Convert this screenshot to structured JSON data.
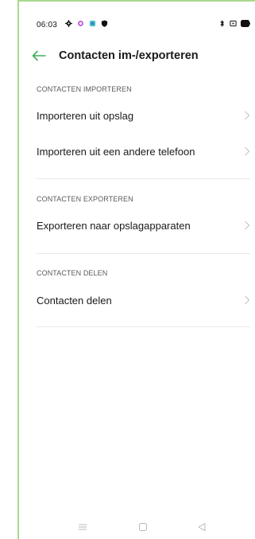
{
  "status_bar": {
    "time": "06:03"
  },
  "header": {
    "title": "Contacten im-/exporteren",
    "back_icon": "back-arrow-icon"
  },
  "colors": {
    "accent": "#3fae57",
    "border": "#a9d98f",
    "text": "#1a1a1a",
    "section_text": "#5a5a5a",
    "chevron": "#c4c4c4"
  },
  "sections": [
    {
      "title": "CONTACTEN IMPORTEREN",
      "items": [
        {
          "label": "Importeren uit opslag"
        },
        {
          "label": "Importeren uit een andere telefoon"
        }
      ]
    },
    {
      "title": "CONTACTEN EXPORTEREN",
      "items": [
        {
          "label": "Exporteren naar opslagapparaten"
        }
      ]
    },
    {
      "title": "CONTACTEN DELEN",
      "items": [
        {
          "label": "Contacten delen"
        }
      ]
    }
  ],
  "nav_bar": {
    "icons": [
      "menu-icon",
      "home-icon",
      "back-triangle-icon"
    ]
  }
}
